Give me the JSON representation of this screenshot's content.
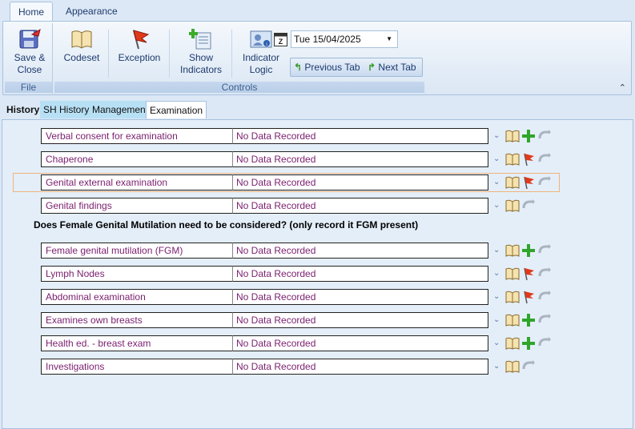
{
  "ribbon_tabs": [
    "Home",
    "Appearance"
  ],
  "file_group": {
    "label": "File",
    "save_close": "Save &\nClose"
  },
  "controls_group": {
    "label": "Controls",
    "codeset": "Codeset",
    "exception": "Exception",
    "show_indicators": "Show\nIndicators",
    "indicator_logic": "Indicator\nLogic",
    "date": "Tue 15/04/2025",
    "previous_tab": "Previous Tab",
    "next_tab": "Next Tab"
  },
  "sub_tabs": [
    "History",
    "SH History",
    "Management",
    "Examination"
  ],
  "question": "Does Female Genital Mutilation need to be considered? (only record it FGM present)",
  "rows": [
    {
      "label": "Verbal consent for examination",
      "value": "No Data Recorded",
      "action": "plus"
    },
    {
      "label": "Chaperone",
      "value": "No Data Recorded",
      "action": "flag"
    },
    {
      "label": "Genital external examination",
      "value": "No Data Recorded",
      "action": "flag"
    },
    {
      "label": "Genital findings",
      "value": "No Data Recorded",
      "action": "none"
    },
    {
      "label": "Female genital mutilation (FGM)",
      "value": "No Data Recorded",
      "action": "plus"
    },
    {
      "label": "Lymph Nodes",
      "value": "No Data Recorded",
      "action": "flag"
    },
    {
      "label": "Abdominal examination",
      "value": "No Data Recorded",
      "action": "flag"
    },
    {
      "label": "Examines own breasts",
      "value": "No Data Recorded",
      "action": "plus"
    },
    {
      "label": "Health ed. - breast exam",
      "value": "No Data Recorded",
      "action": "plus"
    },
    {
      "label": "Investigations",
      "value": "No Data Recorded",
      "action": "none"
    }
  ]
}
